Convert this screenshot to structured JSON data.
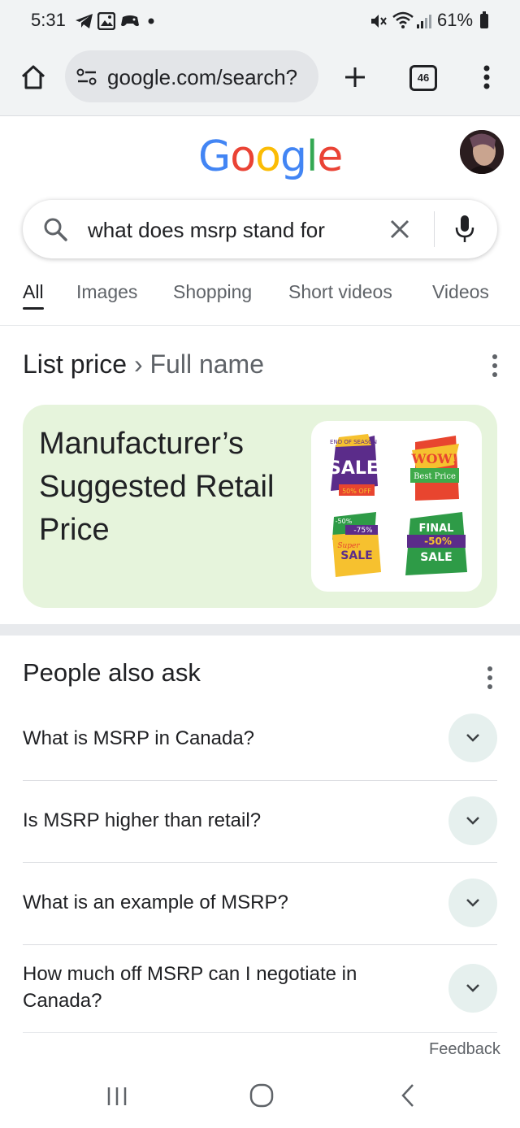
{
  "status_bar": {
    "time": "5:31",
    "battery": "61%",
    "icons": [
      "telegram-icon",
      "gallery-icon",
      "game-icon",
      "dot-icon",
      "mute-icon",
      "wifi-icon",
      "signal-icon",
      "battery-icon"
    ]
  },
  "browser": {
    "url": "google.com/search?",
    "tab_count": "46",
    "icons": [
      "home-icon",
      "site-settings-icon",
      "new-tab-icon",
      "tabs-icon",
      "menu-icon"
    ]
  },
  "google": {
    "logo_letters": [
      "G",
      "o",
      "o",
      "g",
      "l",
      "e"
    ],
    "logo_colors": [
      "#4285F4",
      "#EA4335",
      "#FBBC05",
      "#4285F4",
      "#34A853",
      "#EA4335"
    ]
  },
  "search": {
    "query": "what does msrp stand for"
  },
  "tabs": [
    {
      "label": "All",
      "active": true
    },
    {
      "label": "Images",
      "active": false
    },
    {
      "label": "Shopping",
      "active": false
    },
    {
      "label": "Short videos",
      "active": false
    },
    {
      "label": "Videos",
      "active": false
    }
  ],
  "knowledge_panel": {
    "breadcrumb_main": "List price",
    "breadcrumb_sep": "›",
    "breadcrumb_sub": "Full name",
    "answer": "Manufacturer’s Suggested Retail Price",
    "stickers": [
      {
        "top": "END OF SEASON",
        "main": "SALE",
        "bottom": "50% OFF"
      },
      {
        "top": "WOW!",
        "main": "Best Price"
      },
      {
        "top": "-50%",
        "mid": "-75%",
        "script": "Super",
        "main": "SALE"
      },
      {
        "top": "FINAL",
        "mid": "-50%",
        "main": "SALE"
      }
    ]
  },
  "people_also_ask": {
    "title": "People also ask",
    "questions": [
      "What is MSRP in Canada?",
      "Is MSRP higher than retail?",
      "What is an example of MSRP?",
      "How much off MSRP can I negotiate in Canada?"
    ]
  },
  "feedback": "Feedback",
  "nav_bar": [
    "recents-icon",
    "home-icon",
    "back-icon"
  ]
}
